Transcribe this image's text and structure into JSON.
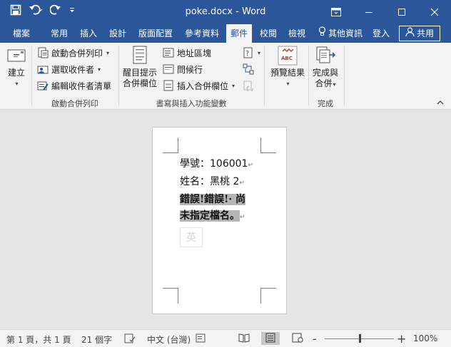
{
  "titlebar": {
    "title": "poke.docx - Word",
    "qat": [
      "save-icon",
      "undo-icon",
      "redo-icon",
      "customize-qat-icon"
    ],
    "controls": [
      "ribbon-display-options-icon",
      "minimize-icon",
      "maximize-icon",
      "close-icon"
    ]
  },
  "tabs": {
    "items": [
      "檔案",
      "常用",
      "插入",
      "設計",
      "版面配置",
      "參考資料",
      "郵件",
      "校閱",
      "檢視"
    ],
    "active": "郵件",
    "tellme": "其他資訊",
    "signin": "登入",
    "share": "共用"
  },
  "ribbon": {
    "create": {
      "label": "建立"
    },
    "start_group": {
      "label": "啟動合併列印",
      "start": "啟動合併列印",
      "select": "選取收件者",
      "edit": "編輯收件者清單"
    },
    "write_group": {
      "label": "書寫與插入功能變數",
      "highlight_line1": "醒目提示",
      "highlight_line2": "合併欄位",
      "address": "地址區塊",
      "greeting": "問候行",
      "insert_field": "插入合併欄位"
    },
    "preview": {
      "label": "預覽結果",
      "icon_text": "ABC"
    },
    "finish_group": {
      "label": "完成",
      "btn_line1": "完成與",
      "btn_line2": "合併"
    }
  },
  "document": {
    "line1": "學號：106001",
    "line2": "姓名：黑桃 2",
    "error_line1": "錯誤!錯誤!· 尚",
    "error_line2": "未指定檔名。",
    "ime_indicator": "英"
  },
  "status": {
    "page": "第 1 頁，共 1 頁",
    "words": "21 個字",
    "language": "中文 (台灣)",
    "zoom": "100%",
    "zoom_minus": "-",
    "zoom_plus": "+",
    "zoom_level_fraction": 0.5
  }
}
